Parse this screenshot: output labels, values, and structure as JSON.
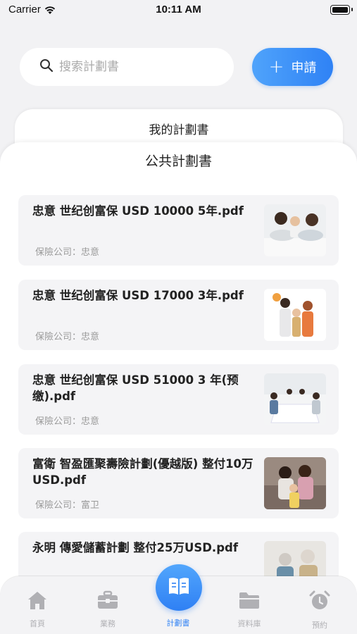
{
  "status_bar": {
    "carrier": "Carrier",
    "time": "10:11 AM"
  },
  "search": {
    "placeholder": "搜索計劃書"
  },
  "apply_button": {
    "label": "申請"
  },
  "tabs_sheet": {
    "my_plans": "我的計劃書",
    "public_plans": "公共計劃書"
  },
  "plans": [
    {
      "title": "忠意 世纪创富保 USD 10000 5年.pdf",
      "company": "保險公司：忠意",
      "thumb": "family-lying-photo"
    },
    {
      "title": "忠意 世纪创富保 USD 17000 3年.pdf",
      "company": "保險公司：忠意",
      "thumb": "family-standing-photo"
    },
    {
      "title": "忠意 世纪创富保 USD 51000 3 年(预缴).pdf",
      "company": "保險公司：忠意",
      "thumb": "meeting-room-photo"
    },
    {
      "title": "富衛 智盈匯聚壽險計劃(優越版) 整付10万USD.pdf",
      "company": "保險公司：富卫",
      "thumb": "family-sofa-photo"
    },
    {
      "title": "永明 傳愛儲蓄計劃 整付25万USD.pdf",
      "company": "",
      "thumb": "elderly-couple-photo"
    }
  ],
  "tab_bar": {
    "items": [
      {
        "label": "首頁",
        "icon": "home-icon"
      },
      {
        "label": "業務",
        "icon": "briefcase-icon"
      },
      {
        "label": "計劃書",
        "icon": "book-icon",
        "active": true
      },
      {
        "label": "資料庫",
        "icon": "folder-icon"
      },
      {
        "label": "預約",
        "icon": "alarm-clock-icon"
      }
    ]
  },
  "colors": {
    "accent": "#2f82f5",
    "inactive": "#b0b0b4",
    "background": "#f2f2f4"
  }
}
